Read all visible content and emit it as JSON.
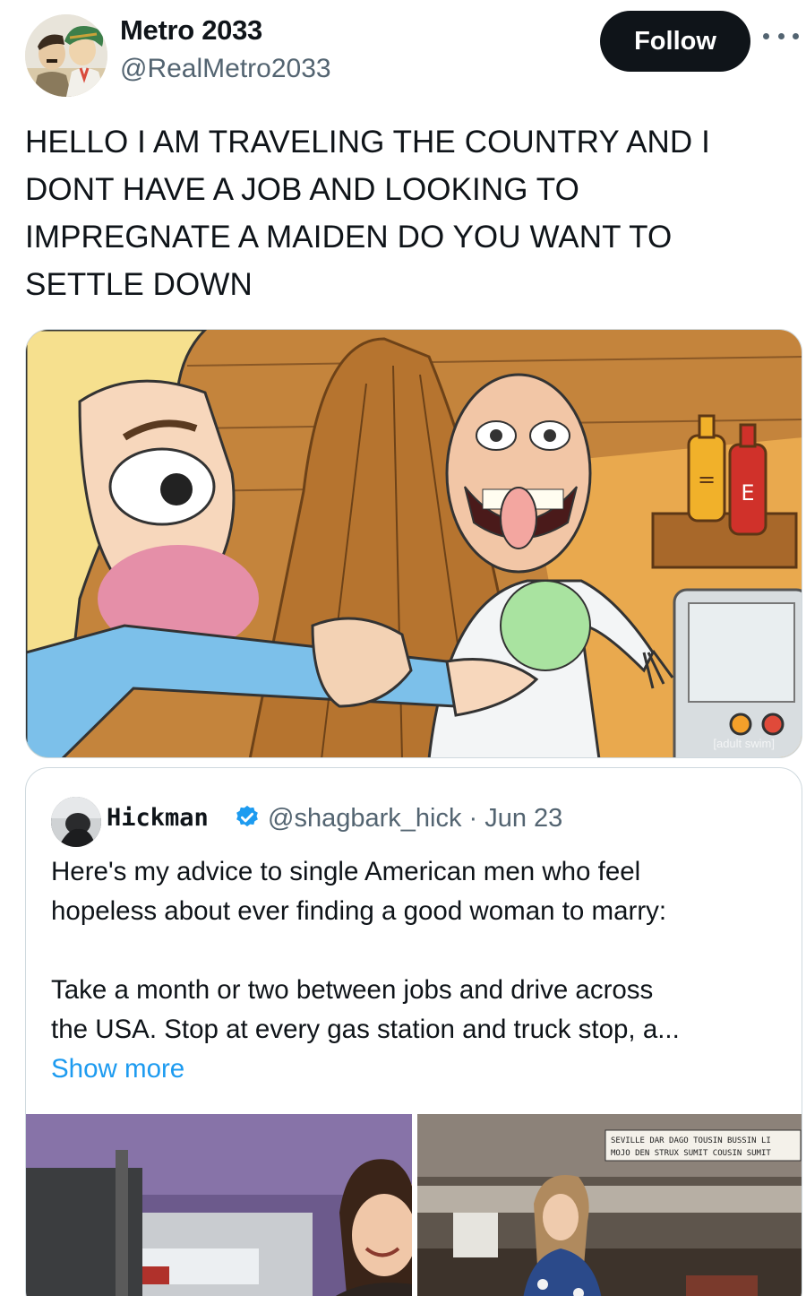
{
  "author": {
    "display_name": "Metro 2033",
    "handle": "@RealMetro2033"
  },
  "follow_label": "Follow",
  "tweet": {
    "lines": [
      "HELLO I AM TRAVELING THE COUNTRY AND I",
      "DONT HAVE A JOB AND LOOKING TO",
      "IMPREGNATE A MAIDEN DO YOU WANT TO",
      "SETTLE DOWN"
    ]
  },
  "media": {
    "watermark": "[adult swim]",
    "condiment_labels": [
      "=",
      "E"
    ]
  },
  "quoted": {
    "name": "Hickman",
    "meta": "@shagbark_hick · Jun 23",
    "para1": [
      "Here's my advice to single American men who feel",
      "hopeless about ever finding a good woman to marry:"
    ],
    "para2": [
      "Take a month or two between jobs and drive across",
      "the USA. Stop at every gas station and truck stop, a..."
    ],
    "show_more": "Show more",
    "photo2_sign": [
      "SEVILLE DAR DAGO TOUSIN BUSSIN LI",
      "MOJO DEN STRUX SUMIT COUSIN SUMIT"
    ]
  },
  "colors": {
    "follow_bg": "#0f1419",
    "link": "#1d9bf0",
    "secondary_text": "#536471",
    "verified": "#1d9bf0"
  },
  "icons": [
    "more-icon",
    "verified-icon"
  ]
}
